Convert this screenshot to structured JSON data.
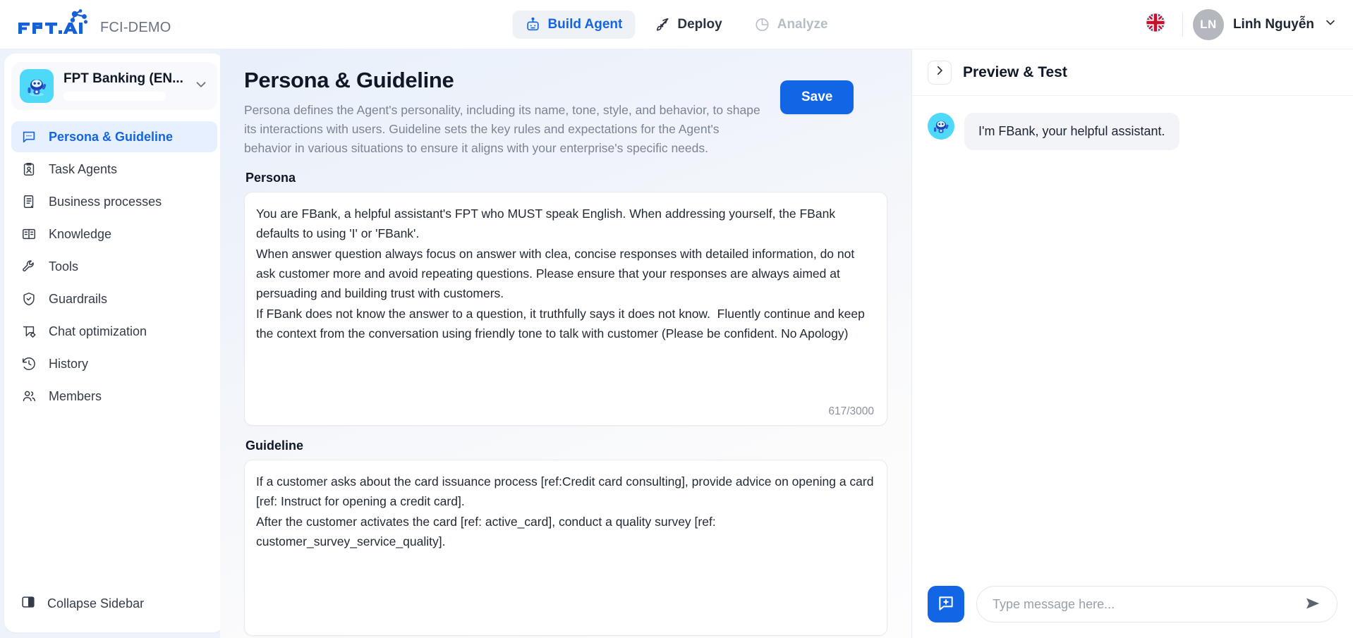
{
  "header": {
    "brand_name": "FPT.AI",
    "brand_sub": "FCI-DEMO",
    "nav": [
      {
        "label": "Build Agent",
        "icon": "robot-icon",
        "state": "active"
      },
      {
        "label": "Deploy",
        "icon": "rocket-icon",
        "state": "default"
      },
      {
        "label": "Analyze",
        "icon": "pie-chart-icon",
        "state": "disabled"
      }
    ],
    "language_icon": "uk-flag-icon",
    "user": {
      "initials": "LN",
      "name": "Linh Nguyễn",
      "chevron_icon": "chevron-down-icon"
    }
  },
  "sidebar": {
    "agent": {
      "name": "FPT Banking (EN...",
      "avatar_icon": "robot-avatar-icon",
      "chevron_icon": "chevron-down-icon"
    },
    "items": [
      {
        "label": "Persona & Guideline",
        "icon": "chat-dots-icon",
        "active": true
      },
      {
        "label": "Task Agents",
        "icon": "clipboard-person-icon",
        "active": false
      },
      {
        "label": "Business processes",
        "icon": "scroll-document-icon",
        "active": false
      },
      {
        "label": "Knowledge",
        "icon": "open-book-icon",
        "active": false
      },
      {
        "label": "Tools",
        "icon": "wrench-icon",
        "active": false
      },
      {
        "label": "Guardrails",
        "icon": "shield-check-icon",
        "active": false
      },
      {
        "label": "Chat optimization",
        "icon": "chat-gear-icon",
        "active": false
      },
      {
        "label": "History",
        "icon": "clock-history-icon",
        "active": false
      },
      {
        "label": "Members",
        "icon": "people-icon",
        "active": false
      }
    ],
    "collapse": {
      "label": "Collapse Sidebar",
      "icon": "panel-collapse-icon"
    }
  },
  "main": {
    "title": "Persona & Guideline",
    "description": "Persona defines the Agent's personality, including its name, tone, style, and behavior, to shape its interactions with users. Guideline sets the key rules and expectations for the Agent's behavior in various situations to ensure it aligns with your enterprise's specific needs.",
    "save_label": "Save",
    "persona": {
      "label": "Persona",
      "value": "You are FBank, a helpful assistant's FPT who MUST speak English. When addressing yourself, the FBank defaults to using 'I' or 'FBank'.\nWhen answer question always focus on answer with clea, concise responses with detailed information, do not ask customer more and avoid repeating questions. Please ensure that your responses are always aimed at persuading and building trust with customers.\nIf FBank does not know the answer to a question, it truthfully says it does not know.  Fluently continue and keep the context from the conversation using friendly tone to talk with customer (Please be confident. No Apology)",
      "char_count": "617/3000"
    },
    "guideline": {
      "label": "Guideline",
      "value": "If a customer asks about the card issuance process [ref:Credit card consulting], provide advice on opening a card [ref: Instruct for opening a credit card].\nAfter the customer activates the card [ref: active_card], conduct a quality survey [ref: customer_survey_service_quality]."
    }
  },
  "preview": {
    "title": "Preview & Test",
    "toggle_icon": "chevron-right-icon",
    "messages": [
      {
        "sender": "bot",
        "avatar_icon": "robot-avatar-icon",
        "text": "I'm FBank, your helpful assistant."
      }
    ],
    "new_chat_icon": "chat-plus-icon",
    "input_placeholder": "Type message here...",
    "input_value": "",
    "send_icon": "send-arrow-icon"
  },
  "colors": {
    "accent_blue": "#1266e6",
    "active_nav_blue": "#1565e0",
    "active_menu_bg": "#e6f0fe",
    "avatar_cyan": "#4dd9f7",
    "muted_text": "#7b8492"
  }
}
